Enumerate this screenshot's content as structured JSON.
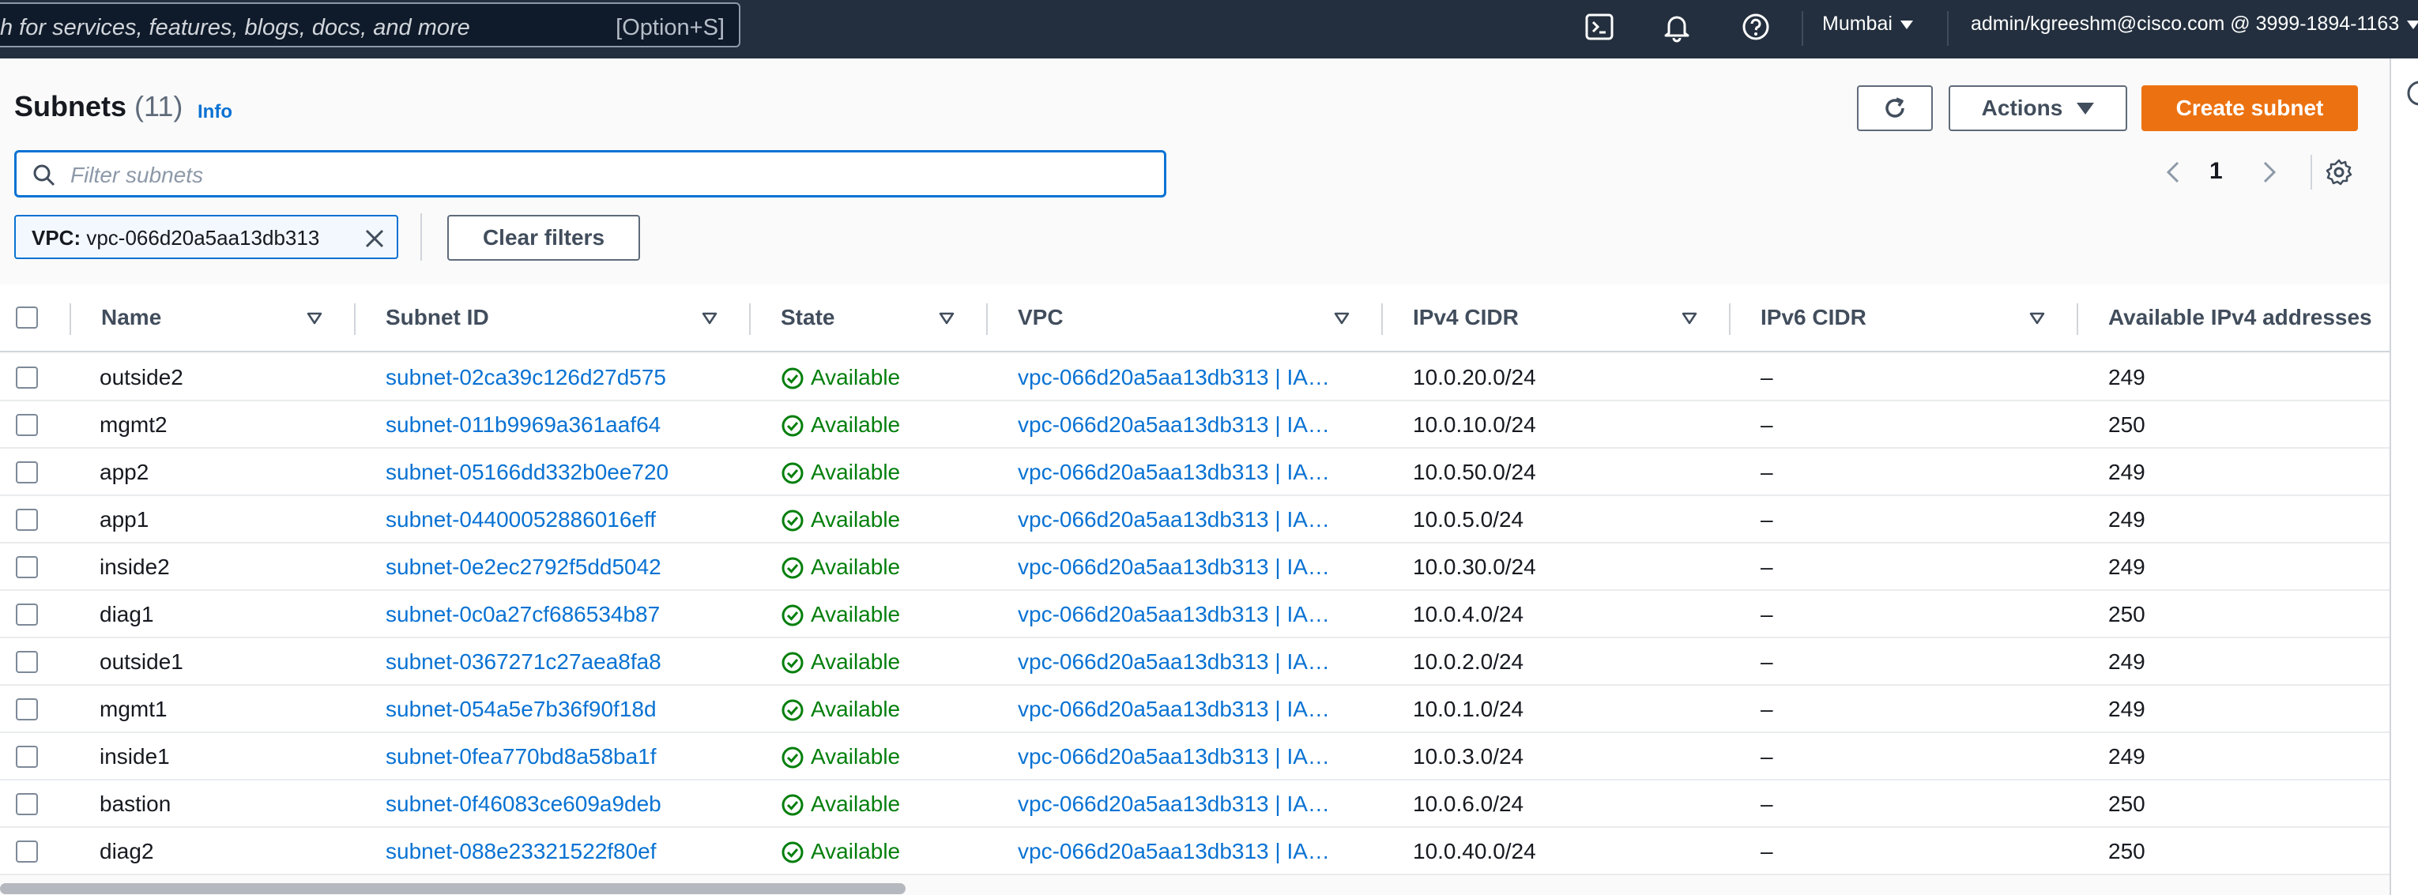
{
  "topnav": {
    "search_placeholder": "h for services, features, blogs, docs, and more",
    "search_shortcut": "[Option+S]",
    "region": "Mumbai",
    "account": "admin/kgreeshm@cisco.com @ 3999-1894-1163"
  },
  "page": {
    "title": "Subnets",
    "count": "(11)",
    "info": "Info"
  },
  "actions": {
    "actions_label": "Actions",
    "create_label": "Create subnet"
  },
  "filter": {
    "placeholder": "Filter subnets",
    "token_key": "VPC:",
    "token_value": " vpc-066d20a5aa13db313",
    "clear_label": "Clear filters"
  },
  "pagination": {
    "current_page": "1"
  },
  "table": {
    "columns": [
      "Name",
      "Subnet ID",
      "State",
      "VPC",
      "IPv4 CIDR",
      "IPv6 CIDR",
      "Available IPv4 addresses"
    ],
    "rows": [
      {
        "name": "outside2",
        "id": "subnet-02ca39c126d27d575",
        "state": "Available",
        "vpc": "vpc-066d20a5aa13db313 | IA…",
        "ipv4": "10.0.20.0/24",
        "ipv6": "–",
        "avail": "249"
      },
      {
        "name": "mgmt2",
        "id": "subnet-011b9969a361aaf64",
        "state": "Available",
        "vpc": "vpc-066d20a5aa13db313 | IA…",
        "ipv4": "10.0.10.0/24",
        "ipv6": "–",
        "avail": "250"
      },
      {
        "name": "app2",
        "id": "subnet-05166dd332b0ee720",
        "state": "Available",
        "vpc": "vpc-066d20a5aa13db313 | IA…",
        "ipv4": "10.0.50.0/24",
        "ipv6": "–",
        "avail": "249"
      },
      {
        "name": "app1",
        "id": "subnet-04400052886016eff",
        "state": "Available",
        "vpc": "vpc-066d20a5aa13db313 | IA…",
        "ipv4": "10.0.5.0/24",
        "ipv6": "–",
        "avail": "249"
      },
      {
        "name": "inside2",
        "id": "subnet-0e2ec2792f5dd5042",
        "state": "Available",
        "vpc": "vpc-066d20a5aa13db313 | IA…",
        "ipv4": "10.0.30.0/24",
        "ipv6": "–",
        "avail": "249"
      },
      {
        "name": "diag1",
        "id": "subnet-0c0a27cf686534b87",
        "state": "Available",
        "vpc": "vpc-066d20a5aa13db313 | IA…",
        "ipv4": "10.0.4.0/24",
        "ipv6": "–",
        "avail": "250"
      },
      {
        "name": "outside1",
        "id": "subnet-0367271c27aea8fa8",
        "state": "Available",
        "vpc": "vpc-066d20a5aa13db313 | IA…",
        "ipv4": "10.0.2.0/24",
        "ipv6": "–",
        "avail": "249"
      },
      {
        "name": "mgmt1",
        "id": "subnet-054a5e7b36f90f18d",
        "state": "Available",
        "vpc": "vpc-066d20a5aa13db313 | IA…",
        "ipv4": "10.0.1.0/24",
        "ipv6": "–",
        "avail": "249"
      },
      {
        "name": "inside1",
        "id": "subnet-0fea770bd8a58ba1f",
        "state": "Available",
        "vpc": "vpc-066d20a5aa13db313 | IA…",
        "ipv4": "10.0.3.0/24",
        "ipv6": "–",
        "avail": "249"
      },
      {
        "name": "bastion",
        "id": "subnet-0f46083ce609a9deb",
        "state": "Available",
        "vpc": "vpc-066d20a5aa13db313 | IA…",
        "ipv4": "10.0.6.0/24",
        "ipv6": "–",
        "avail": "250"
      },
      {
        "name": "diag2",
        "id": "subnet-088e23321522f80ef",
        "state": "Available",
        "vpc": "vpc-066d20a5aa13db313 | IA…",
        "ipv4": "10.0.40.0/24",
        "ipv6": "–",
        "avail": "250"
      }
    ]
  },
  "colors": {
    "nav_bg": "#232f3e",
    "link": "#0972d3",
    "primary": "#ec7211",
    "available": "#037f0c"
  }
}
